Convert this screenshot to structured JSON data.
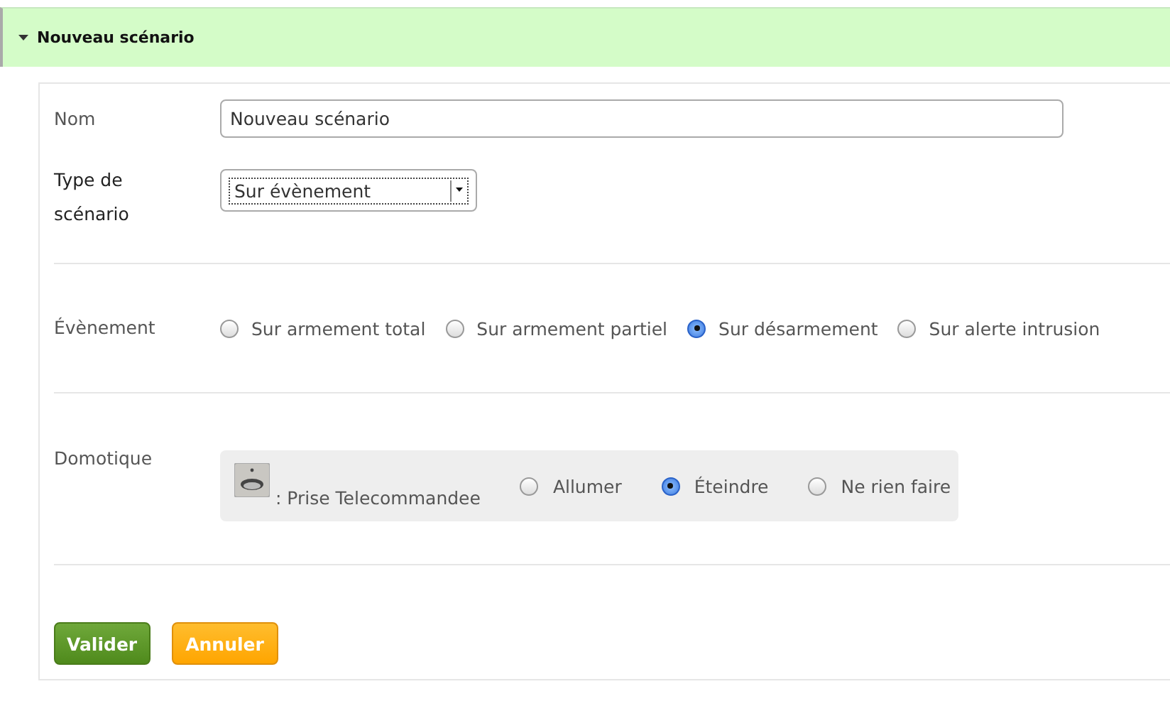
{
  "section": {
    "title": "Nouveau scénario",
    "expanded": true
  },
  "name_field": {
    "label": "Nom",
    "value": "Nouveau scénario"
  },
  "type_field": {
    "label": "Type de scénario",
    "value": "Sur évènement"
  },
  "event": {
    "label": "Évènement",
    "options": [
      {
        "label": "Sur armement total",
        "selected": false
      },
      {
        "label": "Sur armement partiel",
        "selected": false
      },
      {
        "label": "Sur désarmement",
        "selected": true
      },
      {
        "label": "Sur alerte intrusion",
        "selected": false
      }
    ]
  },
  "domotique": {
    "label": "Domotique",
    "device": ": Prise Telecommandee",
    "options": [
      {
        "label": "Allumer",
        "selected": false
      },
      {
        "label": "Éteindre",
        "selected": true
      },
      {
        "label": "Ne rien faire",
        "selected": false
      }
    ]
  },
  "buttons": [
    {
      "label": "Valider",
      "kind": "primary"
    },
    {
      "label": "Annuler",
      "kind": "cancel"
    }
  ]
}
